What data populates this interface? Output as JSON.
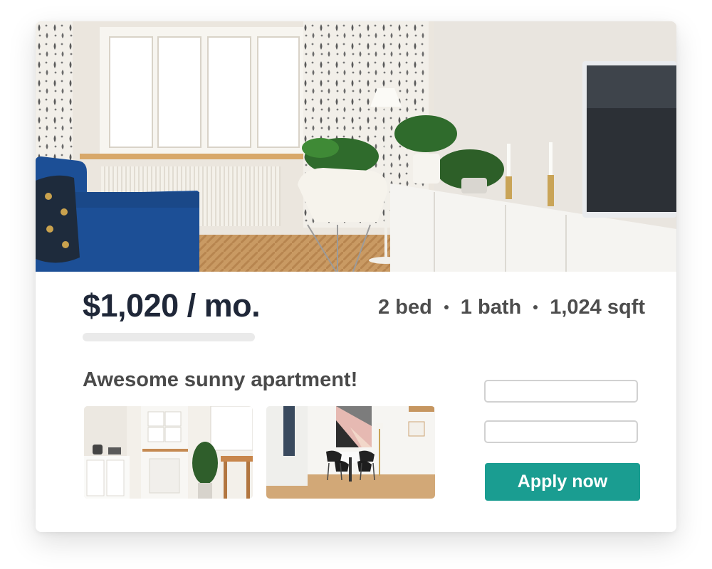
{
  "listing": {
    "price": "$1,020 / mo.",
    "specs": [
      "2 bed",
      "1 bath",
      "1,024 sqft"
    ],
    "title": "Awesome sunny apartment!"
  },
  "form": {
    "field_1_value": "",
    "field_2_value": "",
    "apply_label": "Apply now"
  },
  "colors": {
    "accent": "#1a9d91",
    "price_text": "#1f2738",
    "secondary_text": "#4d4d4d",
    "sofa_blue": "#1c4f96"
  },
  "images": {
    "hero": "living-room-photo",
    "thumbnail_1": "kitchen-photo",
    "thumbnail_2": "dining-room-photo"
  }
}
